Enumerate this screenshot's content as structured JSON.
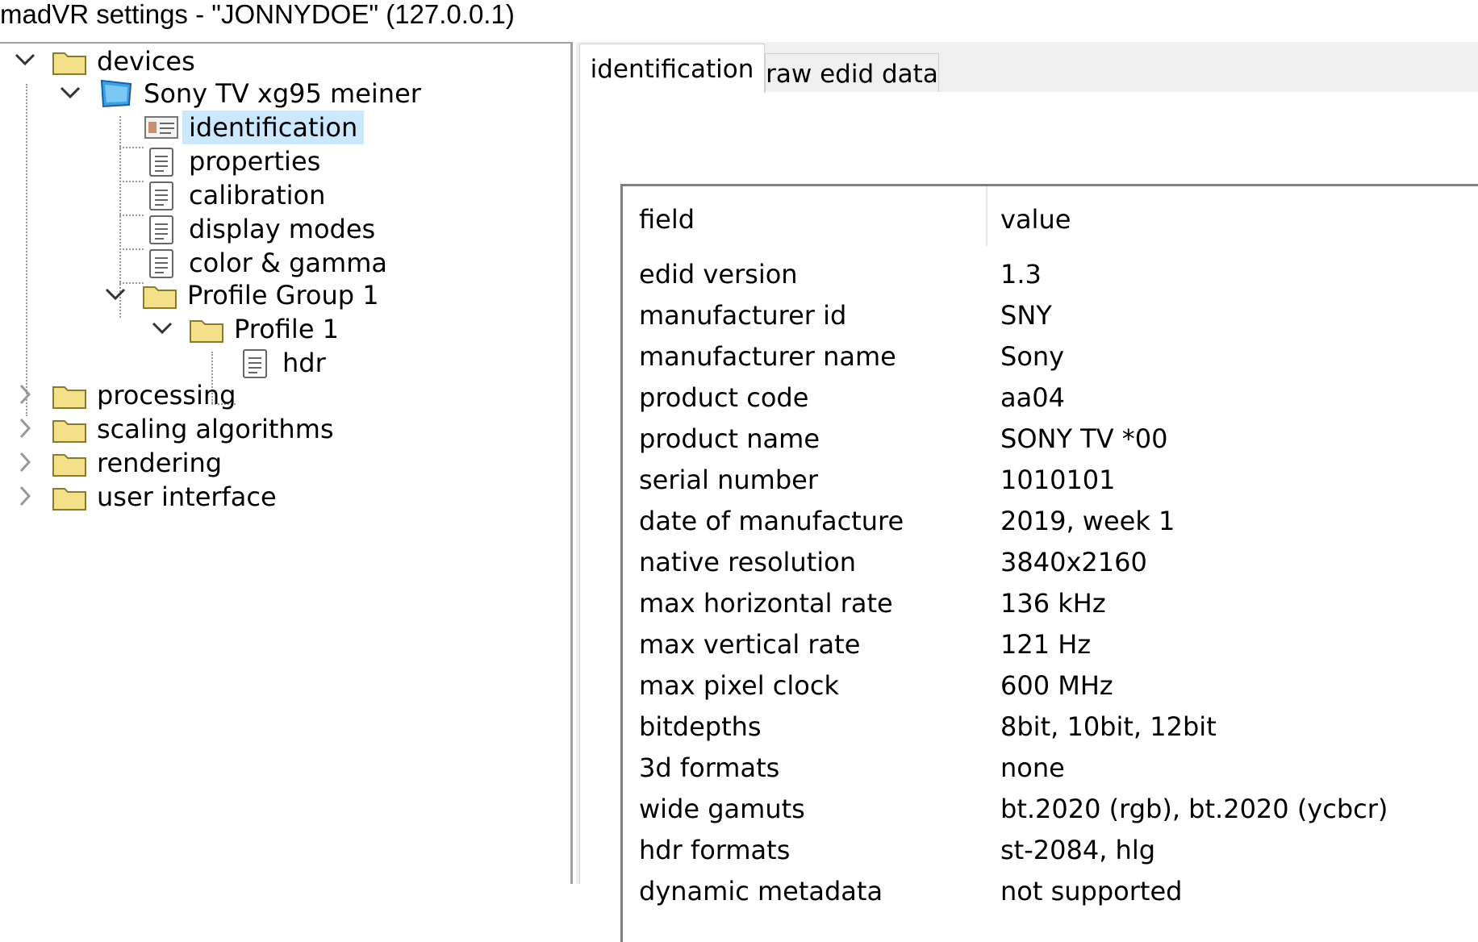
{
  "window": {
    "title": "madVR settings - \"JONNYDOE\" (127.0.0.1)"
  },
  "tree": {
    "devices": "devices",
    "device": "Sony TV xg95 meiner",
    "identification": "identification",
    "properties": "properties",
    "calibration": "calibration",
    "display_modes": "display modes",
    "color_gamma": "color & gamma",
    "profile_group": "Profile Group 1",
    "profile": "Profile 1",
    "hdr": "hdr",
    "processing": "processing",
    "scaling": "scaling algorithms",
    "rendering": "rendering",
    "user_interface": "user interface"
  },
  "tabs": [
    {
      "label": "identification",
      "active": true
    },
    {
      "label": "raw edid data",
      "active": false
    }
  ],
  "table": {
    "headers": [
      "field",
      "value"
    ],
    "rows": [
      [
        "edid version",
        "1.3"
      ],
      [
        "manufacturer id",
        "SNY"
      ],
      [
        "manufacturer name",
        "Sony"
      ],
      [
        "product code",
        "aa04"
      ],
      [
        "product name",
        "SONY TV  *00"
      ],
      [
        "serial number",
        "1010101"
      ],
      [
        "date of manufacture",
        "2019, week 1"
      ],
      [
        "native resolution",
        "3840x2160"
      ],
      [
        "max horizontal rate",
        "136 kHz"
      ],
      [
        "max vertical rate",
        "121 Hz"
      ],
      [
        "max pixel clock",
        "600 MHz"
      ],
      [
        "bitdepths",
        "8bit, 10bit, 12bit"
      ],
      [
        "3d formats",
        "none"
      ],
      [
        "wide gamuts",
        "bt.2020 (rgb), bt.2020 (ycbcr)"
      ],
      [
        "hdr formats",
        "st-2084, hlg"
      ],
      [
        "dynamic metadata",
        "not supported"
      ]
    ]
  },
  "colors": {
    "selection": "#cce8ff",
    "folder": "#f5e08a",
    "pane_border": "#a0a0a0"
  }
}
